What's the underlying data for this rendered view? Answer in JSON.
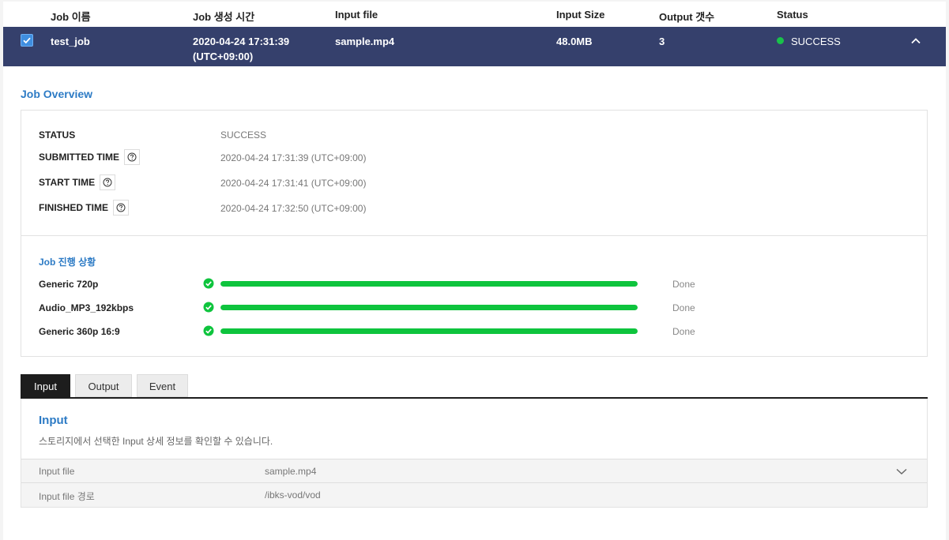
{
  "table": {
    "columns": {
      "name": "Job 이름",
      "created": "Job 생성 시간",
      "input_file": "Input file",
      "input_size": "Input Size",
      "output_count": "Output 갯수",
      "status": "Status"
    },
    "selected_row": {
      "checked": true,
      "name": "test_job",
      "created_line1": "2020-04-24 17:31:39",
      "created_line2": "(UTC+09:00)",
      "input_file": "sample.mp4",
      "input_size": "48.0MB",
      "output_count": "3",
      "status": "SUCCESS",
      "status_color": "#19c24a"
    }
  },
  "overview": {
    "title": "Job Overview",
    "fields": [
      {
        "label": "STATUS",
        "value": "SUCCESS",
        "help": false
      },
      {
        "label": "SUBMITTED TIME",
        "value": "2020-04-24 17:31:39 (UTC+09:00)",
        "help": true
      },
      {
        "label": "START TIME",
        "value": "2020-04-24 17:31:41 (UTC+09:00)",
        "help": true
      },
      {
        "label": "FINISHED TIME",
        "value": "2020-04-24 17:32:50 (UTC+09:00)",
        "help": true
      }
    ],
    "progress_title": "Job 진행 상황",
    "progress": [
      {
        "name": "Generic 720p",
        "percent": 100,
        "status": "Done"
      },
      {
        "name": "Audio_MP3_192kbps",
        "percent": 100,
        "status": "Done"
      },
      {
        "name": "Generic 360p 16:9",
        "percent": 100,
        "status": "Done"
      }
    ]
  },
  "tabs": [
    {
      "label": "Input",
      "active": true
    },
    {
      "label": "Output",
      "active": false
    },
    {
      "label": "Event",
      "active": false
    }
  ],
  "input_panel": {
    "title": "Input",
    "description": "스토리지에서 선택한 Input 상세 정보를 확인할 수 있습니다.",
    "rows": [
      {
        "key": "Input file",
        "value": "sample.mp4",
        "expandable": true
      },
      {
        "key": "Input file 경로",
        "value": "/ibks-vod/vod",
        "expandable": false
      }
    ]
  },
  "colors": {
    "header_row": "#35406c",
    "accent": "#2d7bc5",
    "progress": "#0ec43d",
    "active_tab": "#1d1d1d"
  }
}
